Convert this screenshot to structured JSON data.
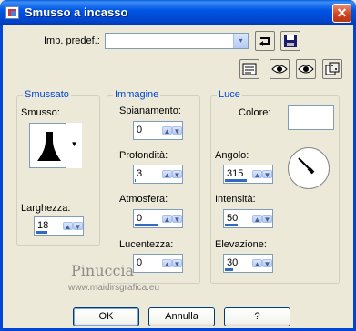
{
  "window": {
    "title": "Smusso a incasso",
    "close_glyph": "✕",
    "icon": "app-icon"
  },
  "presets": {
    "label": "Imp. predef.:",
    "value": "",
    "dropdown_glyph": "▾"
  },
  "toolbar": {
    "reset_icon": "reset-icon",
    "save_icon": "save-icon",
    "dialog_icon": "dialog-options-icon",
    "preview_icon": "preview-eye-icon",
    "proof_icon": "proof-eye-icon",
    "randomize_icon": "dice-icon"
  },
  "smussato": {
    "legend": "Smussato",
    "smusso_label": "Smusso:",
    "larghezza_label": "Larghezza:",
    "larghezza_value": "18",
    "larghezza_fill": 0.45
  },
  "immagine": {
    "legend": "Immagine",
    "spianamento_label": "Spianamento:",
    "spianamento_value": "0",
    "spianamento_fill": 0.0,
    "profondita_label": "Profondità:",
    "profondita_value": "3",
    "profondita_fill": 0.05,
    "atmosfera_label": "Atmosfera:",
    "atmosfera_value": "0",
    "atmosfera_fill": 0.9,
    "lucentezza_label": "Lucentezza:",
    "lucentezza_value": "0",
    "lucentezza_fill": 0.0
  },
  "luce": {
    "legend": "Luce",
    "colore_label": "Colore:",
    "colore_value": "#ffffff",
    "angolo_label": "Angolo:",
    "angolo_value": "315",
    "angolo_fill": 0.87,
    "intensita_label": "Intensità:",
    "intensita_value": "50",
    "intensita_fill": 0.5,
    "elevazione_label": "Elevazione:",
    "elevazione_value": "30",
    "elevazione_fill": 0.33
  },
  "buttons": {
    "ok": "OK",
    "cancel": "Annulla",
    "help": "?"
  },
  "watermark": {
    "name": "Pinuccia",
    "url": "www.maidirsgrafica.eu"
  },
  "spin_up": "▲",
  "spin_down": "▼"
}
